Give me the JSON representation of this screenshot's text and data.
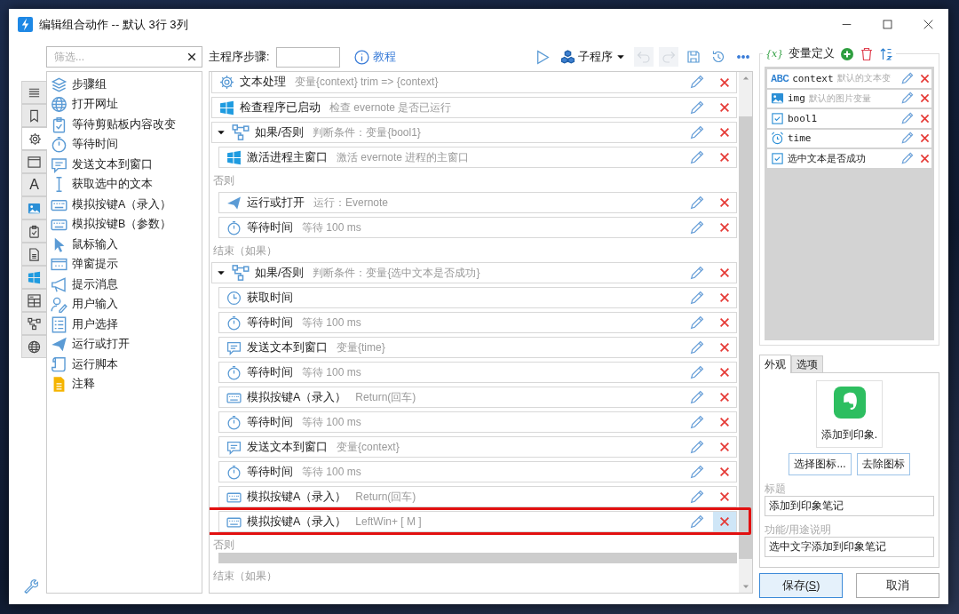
{
  "window": {
    "title": "编辑组合动作 -- 默认 3行 3列"
  },
  "filter": {
    "placeholder": "筛选..."
  },
  "side_tabs": [
    {
      "kind": "menu",
      "selected": false
    },
    {
      "kind": "bookmark",
      "selected": false
    },
    {
      "kind": "gear",
      "selected": true
    },
    {
      "kind": "window",
      "selected": false
    },
    {
      "kind": "letter",
      "glyph": "A",
      "selected": false
    },
    {
      "kind": "image",
      "selected": false
    },
    {
      "kind": "clipboard",
      "selected": false
    },
    {
      "kind": "document",
      "selected": false
    },
    {
      "kind": "windows",
      "selected": false
    },
    {
      "kind": "calc",
      "selected": false
    },
    {
      "kind": "branch",
      "selected": false
    },
    {
      "kind": "globe",
      "selected": false
    }
  ],
  "actions": [
    {
      "kind": "layers",
      "label": "步骤组"
    },
    {
      "kind": "globe",
      "label": "打开网址"
    },
    {
      "kind": "clipboard",
      "label": "等待剪贴板内容改变"
    },
    {
      "kind": "stopwatch",
      "label": "等待时间"
    },
    {
      "kind": "chat",
      "label": "发送文本到窗口"
    },
    {
      "kind": "ibeam",
      "label": "获取选中的文本"
    },
    {
      "kind": "keyboard",
      "label": "模拟按键A（录入）"
    },
    {
      "kind": "keyboard",
      "label": "模拟按键B（参数）"
    },
    {
      "kind": "pointer",
      "label": "鼠标输入"
    },
    {
      "kind": "popup",
      "label": "弹窗提示"
    },
    {
      "kind": "megaphone",
      "label": "提示消息"
    },
    {
      "kind": "user",
      "label": "用户输入"
    },
    {
      "kind": "list",
      "label": "用户选择"
    },
    {
      "kind": "plane",
      "label": "运行或打开"
    },
    {
      "kind": "script",
      "label": "运行脚本"
    },
    {
      "kind": "note",
      "label": "注释"
    }
  ],
  "toolbar": {
    "steps_label": "主程序步骤:",
    "help_link": "教程",
    "subprogram": "子程序",
    "tools": [
      {
        "kind": "play",
        "disabled": false
      },
      {
        "kind": "cubes",
        "disabled": false
      },
      {
        "kind": "undo",
        "disabled": true
      },
      {
        "kind": "redo",
        "disabled": true
      },
      {
        "kind": "save",
        "disabled": false
      },
      {
        "kind": "history",
        "disabled": false
      },
      {
        "kind": "more",
        "disabled": false
      }
    ]
  },
  "steps": [
    {
      "kind": "gear",
      "name": "文本处理",
      "detail": "变量{context} trim => {context}",
      "highlighted": false
    },
    {
      "kind": "windows",
      "name": "检查程序已启动",
      "detail": "检查 evernote 是否已运行",
      "highlighted": false
    },
    {
      "kind": "if",
      "expanded": true,
      "name": "如果/否则",
      "detail": "判断条件：变量{bool1}",
      "else_label": "否则",
      "end_label": "结束（如果）",
      "children": [
        {
          "kind": "windows",
          "name": "激活进程主窗口",
          "detail": "激活 evernote 进程的主窗口",
          "highlighted": false
        }
      ],
      "else_children": [
        {
          "kind": "plane",
          "name": "运行或打开",
          "detail": "运行：Evernote",
          "highlighted": false
        },
        {
          "kind": "stopwatch",
          "name": "等待时间",
          "detail": "等待 100 ms",
          "highlighted": false
        }
      ]
    },
    {
      "kind": "if",
      "expanded": true,
      "name": "如果/否则",
      "detail": "判断条件：变量{选中文本是否成功}",
      "else_label": "否则",
      "end_label": "结束（如果）",
      "children": [
        {
          "kind": "clock",
          "name": "获取时间",
          "highlighted": false
        },
        {
          "kind": "stopwatch",
          "name": "等待时间",
          "detail": "等待 100 ms",
          "highlighted": false
        },
        {
          "kind": "chat",
          "name": "发送文本到窗口",
          "detail": "变量{time}",
          "highlighted": false
        },
        {
          "kind": "stopwatch",
          "name": "等待时间",
          "detail": "等待 100 ms",
          "highlighted": false
        },
        {
          "kind": "keyboard",
          "name": "模拟按键A（录入）",
          "detail": "Return(回车)",
          "highlighted": false
        },
        {
          "kind": "stopwatch",
          "name": "等待时间",
          "detail": "等待 100 ms",
          "highlighted": false
        },
        {
          "kind": "chat",
          "name": "发送文本到窗口",
          "detail": "变量{context}",
          "highlighted": false
        },
        {
          "kind": "stopwatch",
          "name": "等待时间",
          "detail": "等待 100 ms",
          "highlighted": false
        },
        {
          "kind": "keyboard",
          "name": "模拟按键A（录入）",
          "detail": "Return(回车)",
          "highlighted": false
        },
        {
          "kind": "keyboard",
          "name": "模拟按键A（录入）",
          "detail": "LeftWin+ [ M ]",
          "highlighted": true
        }
      ]
    }
  ],
  "variables": {
    "braces": "{x}",
    "title": "变量定义",
    "items": [
      {
        "kind": "text",
        "icon_text": "ABC",
        "name": "context",
        "description": "默认的文本变"
      },
      {
        "kind": "image",
        "name": "img",
        "description": "默认的图片变量"
      },
      {
        "kind": "bool",
        "name": "bool1"
      },
      {
        "kind": "time",
        "name": "time"
      },
      {
        "kind": "bool",
        "name": "选中文本是否成功"
      }
    ]
  },
  "tabs": [
    {
      "label": "外观",
      "selected": true
    },
    {
      "label": "选项",
      "selected": false
    }
  ],
  "appearance": {
    "caption": "添加到印象.",
    "choose_icon": "选择图标...",
    "remove_icon": "去除图标",
    "title_label": "标题",
    "title_value": "添加到印象笔记",
    "desc_label": "功能/用途说明",
    "desc_value": "选中文字添加到印象笔记"
  },
  "buttons": [
    {
      "before": "保存(",
      "key": "S",
      "after": ")",
      "default": true
    },
    {
      "before": "取消",
      "default": false
    }
  ]
}
